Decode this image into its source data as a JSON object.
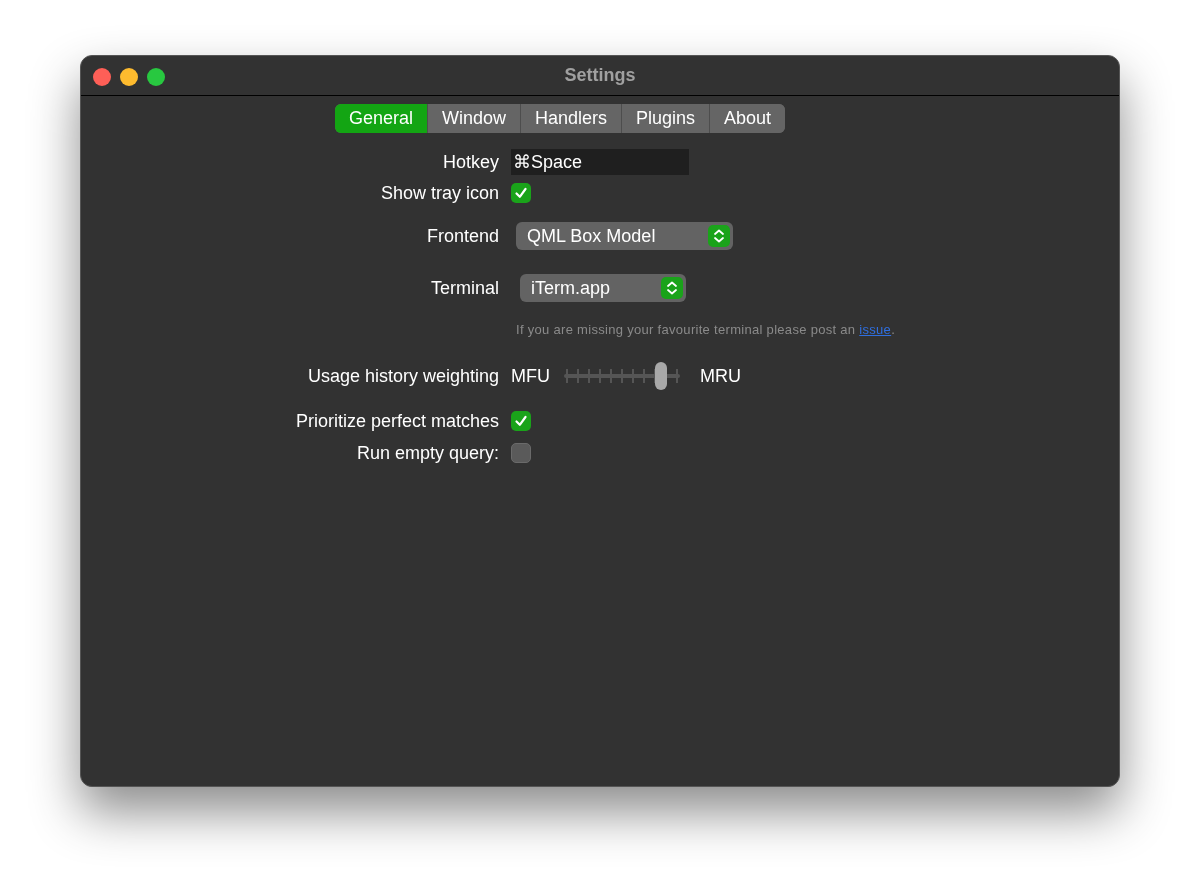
{
  "window": {
    "title": "Settings"
  },
  "tabs": [
    {
      "label": "General",
      "selected": true
    },
    {
      "label": "Window",
      "selected": false
    },
    {
      "label": "Handlers",
      "selected": false
    },
    {
      "label": "Plugins",
      "selected": false
    },
    {
      "label": "About",
      "selected": false
    }
  ],
  "rows": [
    {
      "kind": "field",
      "label": "Hotkey",
      "value": "⌘Space"
    },
    {
      "kind": "checkbox",
      "label": "Show tray icon",
      "checked": true
    },
    {
      "kind": "select",
      "label": "Frontend",
      "value": "QML Box Model"
    },
    {
      "kind": "select",
      "label": "Terminal",
      "value": "iTerm.app"
    },
    {
      "kind": "note",
      "text": "If you are missing your favourite terminal please post an",
      "link": "issue",
      "end": "."
    },
    {
      "kind": "slider",
      "label": "Usage history weighting",
      "min_label": "MFU",
      "max_label": "MRU",
      "level": 0.84
    },
    {
      "kind": "checkbox",
      "label": "Prioritize perfect matches",
      "checked": true
    },
    {
      "kind": "checkbox",
      "label": "Run empty query:",
      "checked": false
    }
  ]
}
